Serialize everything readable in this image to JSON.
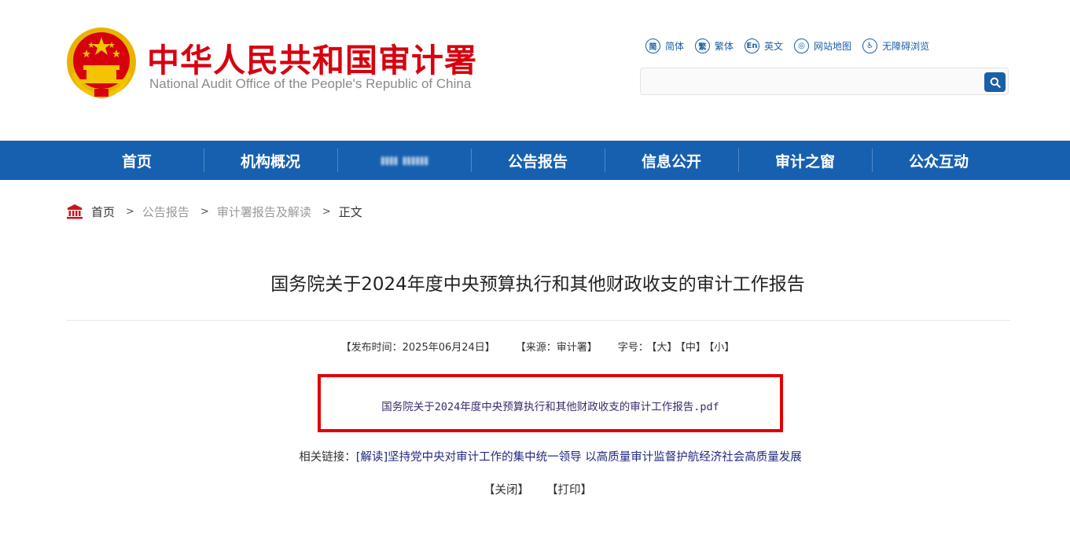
{
  "header": {
    "title": "中华人民共和国审计署",
    "subtitle": "National Audit Office of the People's Republic of China",
    "emblem_icon": "national-emblem-icon"
  },
  "top_links": [
    {
      "glyph": "简",
      "label": "简体"
    },
    {
      "glyph": "繁",
      "label": "繁体"
    },
    {
      "glyph": "En",
      "label": "英文"
    },
    {
      "glyph": "◎",
      "label": "网站地图"
    },
    {
      "glyph": "♿",
      "label": "无障碍浏览"
    }
  ],
  "search": {
    "placeholder": "",
    "value": ""
  },
  "nav": {
    "items": [
      {
        "label": "首页"
      },
      {
        "label": "机构概况"
      },
      {
        "label": "ıııı ıııııı"
      },
      {
        "label": "公告报告"
      },
      {
        "label": "信息公开"
      },
      {
        "label": "审计之窗"
      },
      {
        "label": "公众互动"
      }
    ]
  },
  "breadcrumb": {
    "home": "首页",
    "sep": ">",
    "items": [
      "公告报告",
      "审计署报告及解读"
    ],
    "current": "正文"
  },
  "article": {
    "title": "国务院关于2024年度中央预算执行和其他财政收支的审计工作报告",
    "publish": "【发布时间：2025年06月24日】",
    "source": "【来源：审计署】",
    "font_label": "字号：",
    "size_large": "【大】",
    "size_medium": "【中】",
    "size_small": "【小】",
    "attachment": "国务院关于2024年度中央预算执行和其他财政收支的审计工作报告.pdf",
    "related_label": "相关链接：",
    "related_link": "[解读]坚持党中央对审计工作的集中统一领导 以高质量审计监督护航经济社会高质量发展",
    "close": "【关闭】",
    "print": "【打印】"
  },
  "colors": {
    "brand_red": "#d7000f",
    "nav_blue": "#1760b0",
    "highlight_red": "#e00000"
  }
}
